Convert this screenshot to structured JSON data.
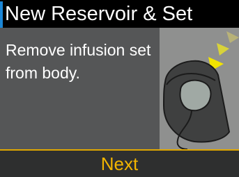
{
  "header": {
    "title": "New Reservoir & Set"
  },
  "main": {
    "message": "Remove infusion set from body."
  },
  "illustration": {
    "icon": "remove-infusion-set-icon"
  },
  "footer": {
    "next_label": "Next"
  },
  "colors": {
    "title_bar": "#000000",
    "accent": "#1b86d6",
    "content_bg": "#555657",
    "footer_bg": "#2e2f2f",
    "footer_line": "#e0a700",
    "next_text": "#f2b500",
    "arrows": "#f2e000"
  }
}
